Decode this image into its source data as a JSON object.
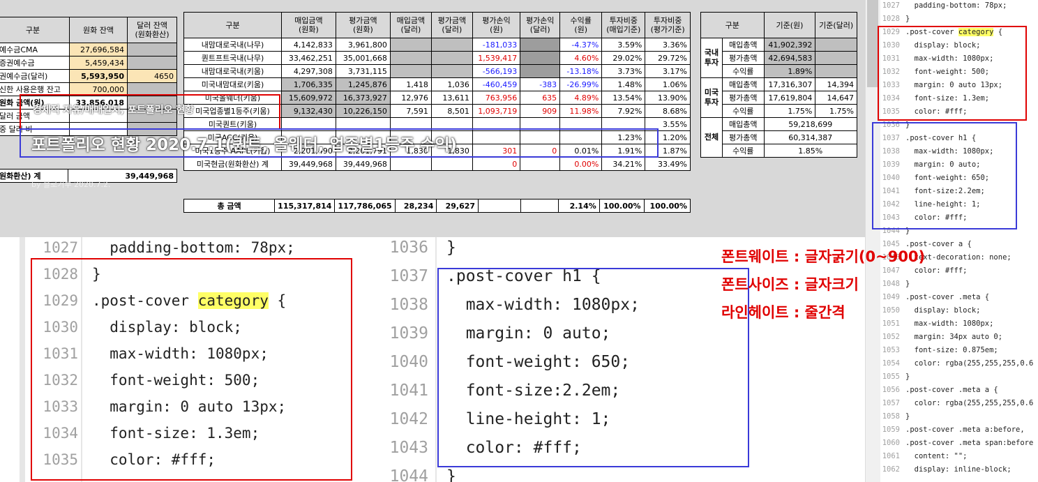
{
  "left_table": {
    "headers": [
      "구분",
      "원화 잔액",
      "달러 잔액\n(원화환산)"
    ],
    "rows": [
      {
        "label": "예수금CMA",
        "krw": "27,696,584",
        "usd": ""
      },
      {
        "label": "증권예수금",
        "krw": "5,459,434",
        "usd": ""
      },
      {
        "label": "권예수금(달러)",
        "krw": "5,593,950",
        "usd": "4650"
      },
      {
        "label": "신한 사용은행 잔고",
        "krw": "700,000",
        "usd": ""
      },
      {
        "label": "원화 금액(원)",
        "krw": "33,856,018",
        "usd": ""
      },
      {
        "label": "달러 금액",
        "krw": "",
        "usd": ""
      },
      {
        "label": "중 달러 비",
        "krw": "",
        "usd": ""
      }
    ],
    "total_label": "원화환산) 계",
    "total_value": "39,449,968"
  },
  "center_table": {
    "headers": [
      "구분",
      "매입금액\n(원화)",
      "평가금액\n(원화)",
      "매입금액\n(달러)",
      "평가금액\n(달러)",
      "평가손익\n(원)",
      "평가손익\n(달러)",
      "수익률\n(원)",
      "투자비중\n(매입기준)",
      "투자비중\n(평가기준)"
    ],
    "rows": [
      [
        "내맘대로국내(나무)",
        "4,142,833",
        "3,961,800",
        "",
        "",
        "-181,033",
        "",
        "-4.37%",
        "3.59%",
        "3.36%"
      ],
      [
        "퀀트프트국내(나무)",
        "33,462,251",
        "35,001,668",
        "",
        "",
        "1,539,417",
        "",
        "4.60%",
        "29.02%",
        "29.72%"
      ],
      [
        "내맘대로국내(키움)",
        "4,297,308",
        "3,731,115",
        "",
        "",
        "-566,193",
        "",
        "-13.18%",
        "3.73%",
        "3.17%"
      ],
      [
        "미국내맘대로(키움)",
        "1,706,335",
        "1,245,876",
        "1,418",
        "1,036",
        "-460,459",
        "-383",
        "-26.99%",
        "1.48%",
        "1.06%"
      ],
      [
        "미국올웨더(키움)",
        "15,609,972",
        "16,373,927",
        "12,976",
        "13,611",
        "763,956",
        "635",
        "4.89%",
        "13.54%",
        "13.90%"
      ],
      [
        "미국업종별1등주(키움)",
        "9,132,430",
        "10,226,150",
        "7,591",
        "8,501",
        "1,093,719",
        "909",
        "11.98%",
        "7.92%",
        "8.68%"
      ],
      [
        "미국퀀트(키움)",
        "",
        "",
        "",
        "",
        "",
        "",
        "",
        "",
        "3.55%"
      ],
      [
        "미국ACC(키움)",
        "",
        "",
        "",
        "",
        "",
        "",
        "",
        "1.23%",
        "1.20%"
      ],
      [
        "미국1등주 AAPL(키움)",
        "2,201,490",
        "2,201,791",
        "1,830",
        "1,830",
        "301",
        "0",
        "0.01%",
        "1.91%",
        "1.87%"
      ],
      [
        "미국현금(원화환산) 계",
        "39,449,968",
        "39,449,968",
        "",
        "",
        "0",
        "",
        "0.00%",
        "34.21%",
        "33.49%"
      ]
    ],
    "total": [
      "총 금액",
      "115,317,814",
      "117,786,065",
      "28,234",
      "29,627",
      "",
      "",
      "2.14%",
      "100.00%",
      "100.00%"
    ]
  },
  "right_table": {
    "headers": [
      "구분",
      "",
      "기준(원)",
      "기준(달러)"
    ],
    "groups": [
      {
        "name": "국내\n투자",
        "rows": [
          [
            "매입총액",
            "41,902,392",
            ""
          ],
          [
            "평가총액",
            "42,694,583",
            ""
          ],
          [
            "수익률",
            "1.89%",
            ""
          ]
        ]
      },
      {
        "name": "미국\n투자",
        "rows": [
          [
            "매입총액",
            "17,316,307",
            "14,394"
          ],
          [
            "평가총액",
            "17,619,804",
            "14,647"
          ],
          [
            "수익률",
            "1.75%",
            "1.75%"
          ]
        ]
      },
      {
        "name": "전체",
        "rows": [
          [
            "매입총액",
            "59,218,699",
            ""
          ],
          [
            "평가총액",
            "60,314,387",
            ""
          ],
          [
            "수익률",
            "1.85%",
            ""
          ]
        ]
      }
    ]
  },
  "overlay": {
    "category_text": "경제적 자유/매매일지, 포트폴리오 현황",
    "title_text": "포트폴리오 현황 2020.7.1(퀀트, 올웨더, 업종별1등주 수익)",
    "meta_text": "by 블로거부    2020.7.2."
  },
  "code_a": {
    "lines": [
      {
        "n": "1027",
        "t": "  padding-bottom: 78px;"
      },
      {
        "n": "1028",
        "t": "}"
      },
      {
        "n": "1029",
        "t": ".post-cover .category {"
      },
      {
        "n": "1030",
        "t": "  display: block;"
      },
      {
        "n": "1031",
        "t": "  max-width: 1080px;"
      },
      {
        "n": "1032",
        "t": "  font-weight: 500;"
      },
      {
        "n": "1033",
        "t": "  margin: 0 auto 13px;"
      },
      {
        "n": "1034",
        "t": "  font-size: 1.3em;"
      },
      {
        "n": "1035",
        "t": "  color: #fff;"
      }
    ]
  },
  "code_b": {
    "lines": [
      {
        "n": "1036",
        "t": "}"
      },
      {
        "n": "1037",
        "t": ".post-cover h1 {"
      },
      {
        "n": "1038",
        "t": "  max-width: 1080px;"
      },
      {
        "n": "1039",
        "t": "  margin: 0 auto;"
      },
      {
        "n": "1040",
        "t": "  font-weight: 650;"
      },
      {
        "n": "1041",
        "t": "  font-size:2.2em;"
      },
      {
        "n": "1042",
        "t": "  line-height: 1;"
      },
      {
        "n": "1043",
        "t": "  color: #fff;"
      },
      {
        "n": "1044",
        "t": "}"
      }
    ]
  },
  "code_c": {
    "lines": [
      {
        "n": "1027",
        "t": "  padding-bottom: 78px;"
      },
      {
        "n": "1028",
        "t": "}"
      },
      {
        "n": "1029",
        "t": ".post-cover .category {"
      },
      {
        "n": "1030",
        "t": "  display: block;"
      },
      {
        "n": "1031",
        "t": "  max-width: 1080px;"
      },
      {
        "n": "1032",
        "t": "  font-weight: 500;"
      },
      {
        "n": "1033",
        "t": "  margin: 0 auto 13px;"
      },
      {
        "n": "1034",
        "t": "  font-size: 1.3em;"
      },
      {
        "n": "1035",
        "t": "  color: #fff;"
      },
      {
        "n": "1036",
        "t": "}"
      },
      {
        "n": "1037",
        "t": ".post-cover h1 {"
      },
      {
        "n": "1038",
        "t": "  max-width: 1080px;"
      },
      {
        "n": "1039",
        "t": "  margin: 0 auto;"
      },
      {
        "n": "1040",
        "t": "  font-weight: 650;"
      },
      {
        "n": "1041",
        "t": "  font-size:2.2em;"
      },
      {
        "n": "1042",
        "t": "  line-height: 1;"
      },
      {
        "n": "1043",
        "t": "  color: #fff;"
      },
      {
        "n": "1044",
        "t": "}"
      },
      {
        "n": "1045",
        "t": ".post-cover a {"
      },
      {
        "n": "1046",
        "t": "  text-decoration: none;"
      },
      {
        "n": "1047",
        "t": "  color: #fff;"
      },
      {
        "n": "1048",
        "t": "}"
      },
      {
        "n": "1049",
        "t": ".post-cover .meta {"
      },
      {
        "n": "1050",
        "t": "  display: block;"
      },
      {
        "n": "1051",
        "t": "  max-width: 1080px;"
      },
      {
        "n": "1052",
        "t": "  margin: 34px auto 0;"
      },
      {
        "n": "1053",
        "t": "  font-size: 0.875em;"
      },
      {
        "n": "1054",
        "t": "  color: rgba(255,255,255,0.6"
      },
      {
        "n": "1055",
        "t": "}"
      },
      {
        "n": "1056",
        "t": ".post-cover .meta a {"
      },
      {
        "n": "1057",
        "t": "  color: rgba(255,255,255,0.6"
      },
      {
        "n": "1058",
        "t": "}"
      },
      {
        "n": "1059",
        "t": ".post-cover .meta a:before,"
      },
      {
        "n": "1060",
        "t": ".post-cover .meta span:before"
      },
      {
        "n": "1061",
        "t": "  content: \"\";"
      },
      {
        "n": "1062",
        "t": "  display: inline-block;"
      }
    ]
  },
  "notes": {
    "weight": "폰트웨이트 : 글자굵기(0~900)",
    "size": "폰트사이즈 :  글자크기",
    "lineheight": "라인헤이트 : 줄간격"
  },
  "colors": {
    "annot_red": "#e00000",
    "annot_blue": "#3a3ad8",
    "highlight": "#ffff66"
  }
}
